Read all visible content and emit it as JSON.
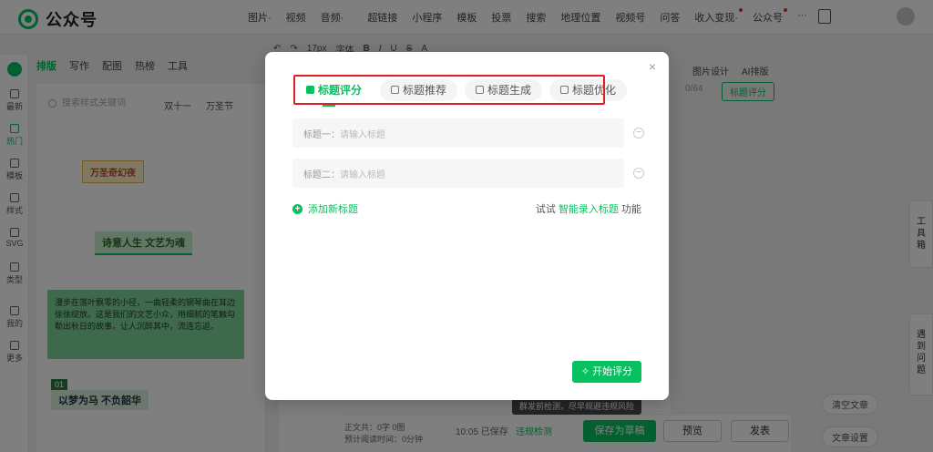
{
  "app": {
    "logo_text": "公众号"
  },
  "topnav": [
    "图片·",
    "视频",
    "音频·",
    "超链接",
    "小程序",
    "模板",
    "投票",
    "搜索",
    "地理位置",
    "视频号",
    "问答",
    "收入变现·",
    "公众号",
    "···"
  ],
  "toolbar": {
    "font_size": "17px",
    "font_face": "字体",
    "bold": "B",
    "italic": "I",
    "underline": "U",
    "strike": "S",
    "text_color": "A"
  },
  "left_sidebar": [
    "最新",
    "热门",
    "模板",
    "样式",
    "SVG",
    "类型",
    "我的",
    "更多"
  ],
  "panel_tabs": [
    "排版",
    "写作",
    "配图",
    "热榜",
    "工具"
  ],
  "style_panel": {
    "search_placeholder": "搜索样式关键词",
    "festival_1": "双十一",
    "festival_2": "万圣节",
    "sample_1": "万圣奇幻夜",
    "sample_2": "诗意人生 文艺为魂",
    "sample_3": "漫步在落叶飘零的小径，一曲轻柔的钢琴曲在耳边徐徐绽放。这是我们的文艺小众，用细腻的笔触勾勒出秋日的故事，让人沉醉其中，流连忘返。",
    "sample_4_no": "01",
    "sample_4": "以梦为马 不负韶华"
  },
  "editor": {
    "counter": "0/64",
    "score_pill": "标题评分",
    "tools": [
      "图片设计",
      "AI排版"
    ]
  },
  "side_tools": {
    "toolbox": "工具箱",
    "issues": "遇到问题"
  },
  "bottom": {
    "stats_1": "正文共：0字 0图",
    "stats_2": "预计阅读时间：0分钟",
    "saved": "10:05 已保存",
    "check": "违规检测",
    "tooltip": "群发前检测，尽早规避违规风险",
    "save_draft": "保存为草稿",
    "preview": "预览",
    "publish": "发表",
    "clear": "清空文章",
    "settings": "文章设置"
  },
  "modal": {
    "tabs": [
      "标题评分",
      "标题推荐",
      "标题生成",
      "标题优化"
    ],
    "active_tab": 0,
    "fields": [
      {
        "label": "标题一：",
        "placeholder": "请输入标题"
      },
      {
        "label": "标题二：",
        "placeholder": "请输入标题"
      }
    ],
    "add_title": "添加新标题",
    "try_prefix": "试试",
    "try_link": "智能录入标题",
    "try_suffix": "功能",
    "start_button": "开始评分",
    "accent_color": "#07c160",
    "highlight_color": "#e02020"
  }
}
